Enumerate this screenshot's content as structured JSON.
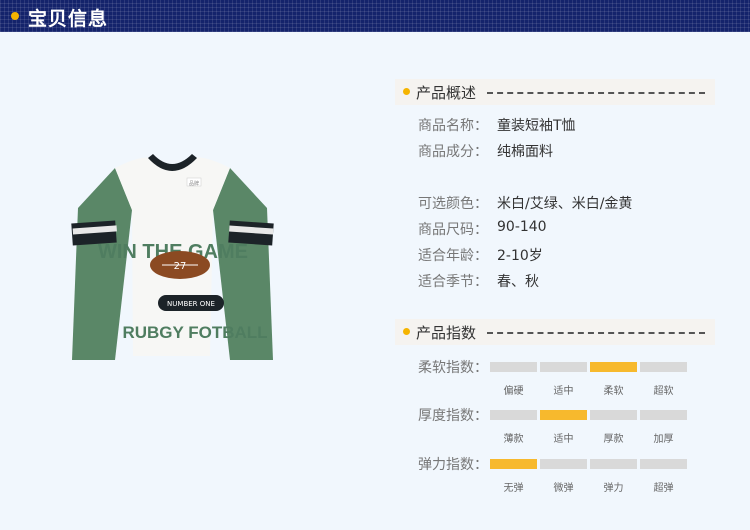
{
  "banner": {
    "title": "宝贝信息"
  },
  "product_image": {
    "print_line1": "WIN THE GAME",
    "ball_number": "27",
    "badge": "NUMBER ONE",
    "print_line2": "RUBGY FOTBALL",
    "tag": "品牌"
  },
  "overview": {
    "title": "产品概述",
    "rows": [
      {
        "label": "商品名称：",
        "value": "童装短袖T恤"
      },
      {
        "label": "商品成分：",
        "value": "纯棉面料"
      },
      {
        "label": "可选颜色：",
        "value": "米白/艾绿、米白/金黄"
      },
      {
        "label": "商品尺码：",
        "value": "90-140"
      },
      {
        "label": "适合年龄：",
        "value": "2-10岁"
      },
      {
        "label": "适合季节：",
        "value": "春、秋"
      }
    ]
  },
  "indices": {
    "title": "产品指数",
    "items": [
      {
        "label": "柔软指数：",
        "options": [
          "偏硬",
          "适中",
          "柔软",
          "超软"
        ],
        "selected_index": 2
      },
      {
        "label": "厚度指数：",
        "options": [
          "薄款",
          "适中",
          "厚款",
          "加厚"
        ],
        "selected_index": 1
      },
      {
        "label": "弹力指数：",
        "options": [
          "无弹",
          "微弹",
          "弹力",
          "超弹"
        ],
        "selected_index": 0
      }
    ]
  },
  "colors": {
    "accent": "#f7b92d",
    "banner": "#14236b",
    "sleeve": "#5a8767"
  }
}
